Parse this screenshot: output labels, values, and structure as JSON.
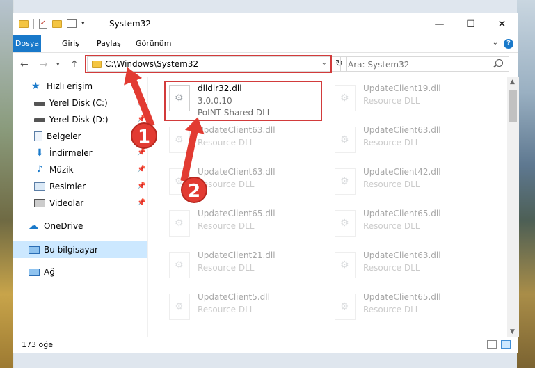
{
  "window": {
    "title": "System32",
    "controls": {
      "minimize": "—",
      "maximize": "☐",
      "close": "✕"
    }
  },
  "ribbon": {
    "tabs": [
      "Dosya",
      "Giriş",
      "Paylaş",
      "Görünüm"
    ],
    "help": "?"
  },
  "address": {
    "path": "C:\\Windows\\System32",
    "refresh_icon": "↻",
    "search_placeholder": "Ara: System32"
  },
  "nav": {
    "items": [
      {
        "label": "Hızlı erişim",
        "icon": "star-icon",
        "pinned": false
      },
      {
        "label": "Yerel Disk (C:)",
        "icon": "drive-icon",
        "pinned": true
      },
      {
        "label": "Yerel Disk (D:)",
        "icon": "drive-icon",
        "pinned": true
      },
      {
        "label": "Belgeler",
        "icon": "documents-icon",
        "pinned": true
      },
      {
        "label": "İndirmeler",
        "icon": "downloads-icon",
        "pinned": true
      },
      {
        "label": "Müzik",
        "icon": "music-icon",
        "pinned": true
      },
      {
        "label": "Resimler",
        "icon": "pictures-icon",
        "pinned": true
      },
      {
        "label": "Videolar",
        "icon": "videos-icon",
        "pinned": true
      },
      {
        "label": "OneDrive",
        "icon": "onedrive-icon",
        "pinned": false
      },
      {
        "label": "Bu bilgisayar",
        "icon": "computer-icon",
        "pinned": false,
        "selected": true
      },
      {
        "label": "Ağ",
        "icon": "network-icon",
        "pinned": false
      }
    ]
  },
  "files": {
    "highlighted": {
      "name": "dlldir32.dll",
      "version": "3.0.0.10",
      "description": "PoINT Shared DLL"
    },
    "left_column": [
      {
        "name": "UpdateClient63.dll",
        "description": "Resource DLL"
      },
      {
        "name": "UpdateClient63.dll",
        "description": "Resource DLL"
      },
      {
        "name": "UpdateClient65.dll",
        "description": "Resource DLL"
      },
      {
        "name": "UpdateClient21.dll",
        "description": "Resource DLL"
      },
      {
        "name": "UpdateClient5.dll",
        "description": "Resource DLL"
      }
    ],
    "right_column": [
      {
        "name": "UpdateClient19.dll",
        "description": "Resource DLL"
      },
      {
        "name": "UpdateClient63.dll",
        "description": "Resource DLL"
      },
      {
        "name": "UpdateClient42.dll",
        "description": "Resource DLL"
      },
      {
        "name": "UpdateClient65.dll",
        "description": "Resource DLL"
      },
      {
        "name": "UpdateClient63.dll",
        "description": "Resource DLL"
      },
      {
        "name": "UpdateClient65.dll",
        "description": "Resource DLL"
      }
    ]
  },
  "status": {
    "count": "173 öğe"
  },
  "callouts": [
    "1",
    "2"
  ],
  "colors": {
    "accent": "#1979ca",
    "highlight": "#d23b3b",
    "selected_bg": "#cce8ff"
  }
}
